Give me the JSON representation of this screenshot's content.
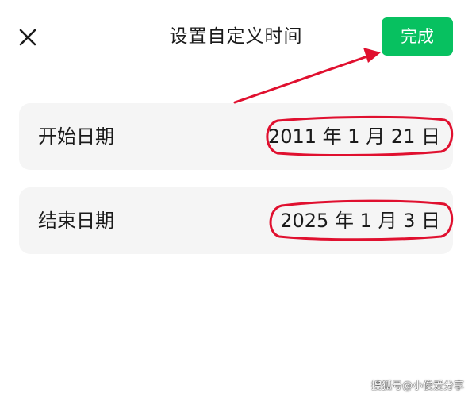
{
  "header": {
    "title": "设置自定义时间",
    "done_label": "完成",
    "close_icon": "close-icon"
  },
  "start": {
    "label": "开始日期",
    "value": "2011 年 1 月 21 日"
  },
  "end": {
    "label": "结束日期",
    "value": "2025 年 1 月 3 日"
  },
  "watermark": "搜狐号@小俊爱分享",
  "colors": {
    "accent": "#07c160",
    "annotation": "#e0102f",
    "card_background": "#f5f5f5"
  }
}
